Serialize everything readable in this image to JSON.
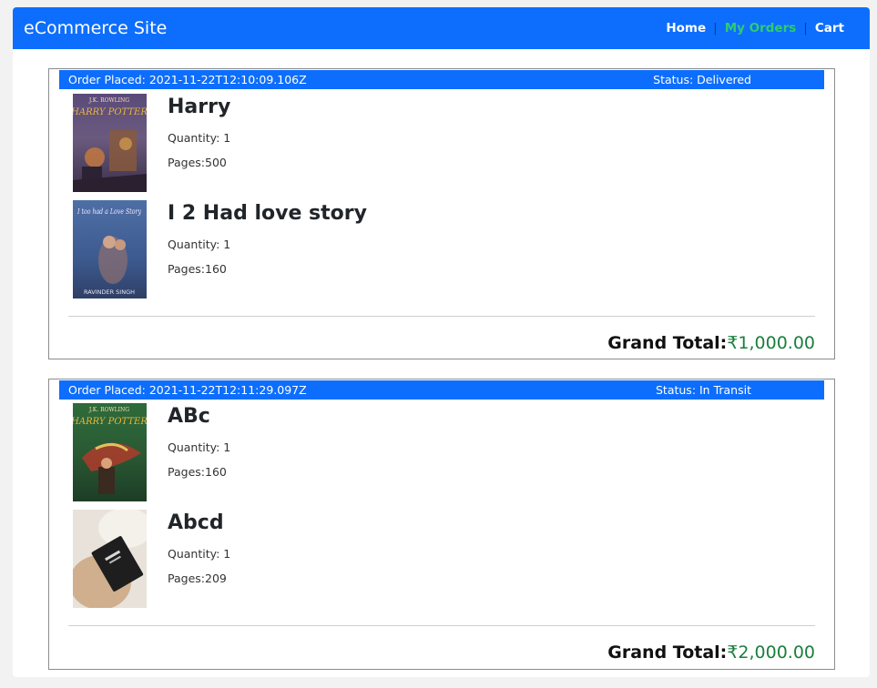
{
  "app": {
    "title": "eCommerce Site"
  },
  "nav": {
    "home": "Home",
    "orders": "My Orders",
    "cart": "Cart",
    "separator": "|"
  },
  "orders": [
    {
      "placed": "Order Placed: 2021-11-22T12:10:09.106Z",
      "status": "Status: Delivered",
      "items": [
        {
          "title": "Harry",
          "quantity": "Quantity: 1",
          "pages": "Pages:500",
          "cover_text": "J.K. ROWLING",
          "cover_title": "HARRY POTTER"
        },
        {
          "title": "I 2 Had love story",
          "quantity": "Quantity: 1",
          "pages": "Pages:160",
          "cover_text": "I too had a Love Story",
          "cover_author": "RAVINDER SINGH"
        }
      ],
      "grand_label": "Grand Total:",
      "grand_amount": "₹1,000.00"
    },
    {
      "placed": "Order Placed: 2021-11-22T12:11:29.097Z",
      "status": "Status: In Transit",
      "items": [
        {
          "title": "ABc",
          "quantity": "Quantity: 1",
          "pages": "Pages:160",
          "cover_text": "J.K. ROWLING",
          "cover_title": "HARRY POTTER"
        },
        {
          "title": "Abcd",
          "quantity": "Quantity: 1",
          "pages": "Pages:209"
        }
      ],
      "grand_label": "Grand Total:",
      "grand_amount": "₹2,000.00"
    }
  ],
  "colors": {
    "navbar": "#0d6efd",
    "active_link": "#2ecc71",
    "total_amount": "#1a7f3c"
  }
}
